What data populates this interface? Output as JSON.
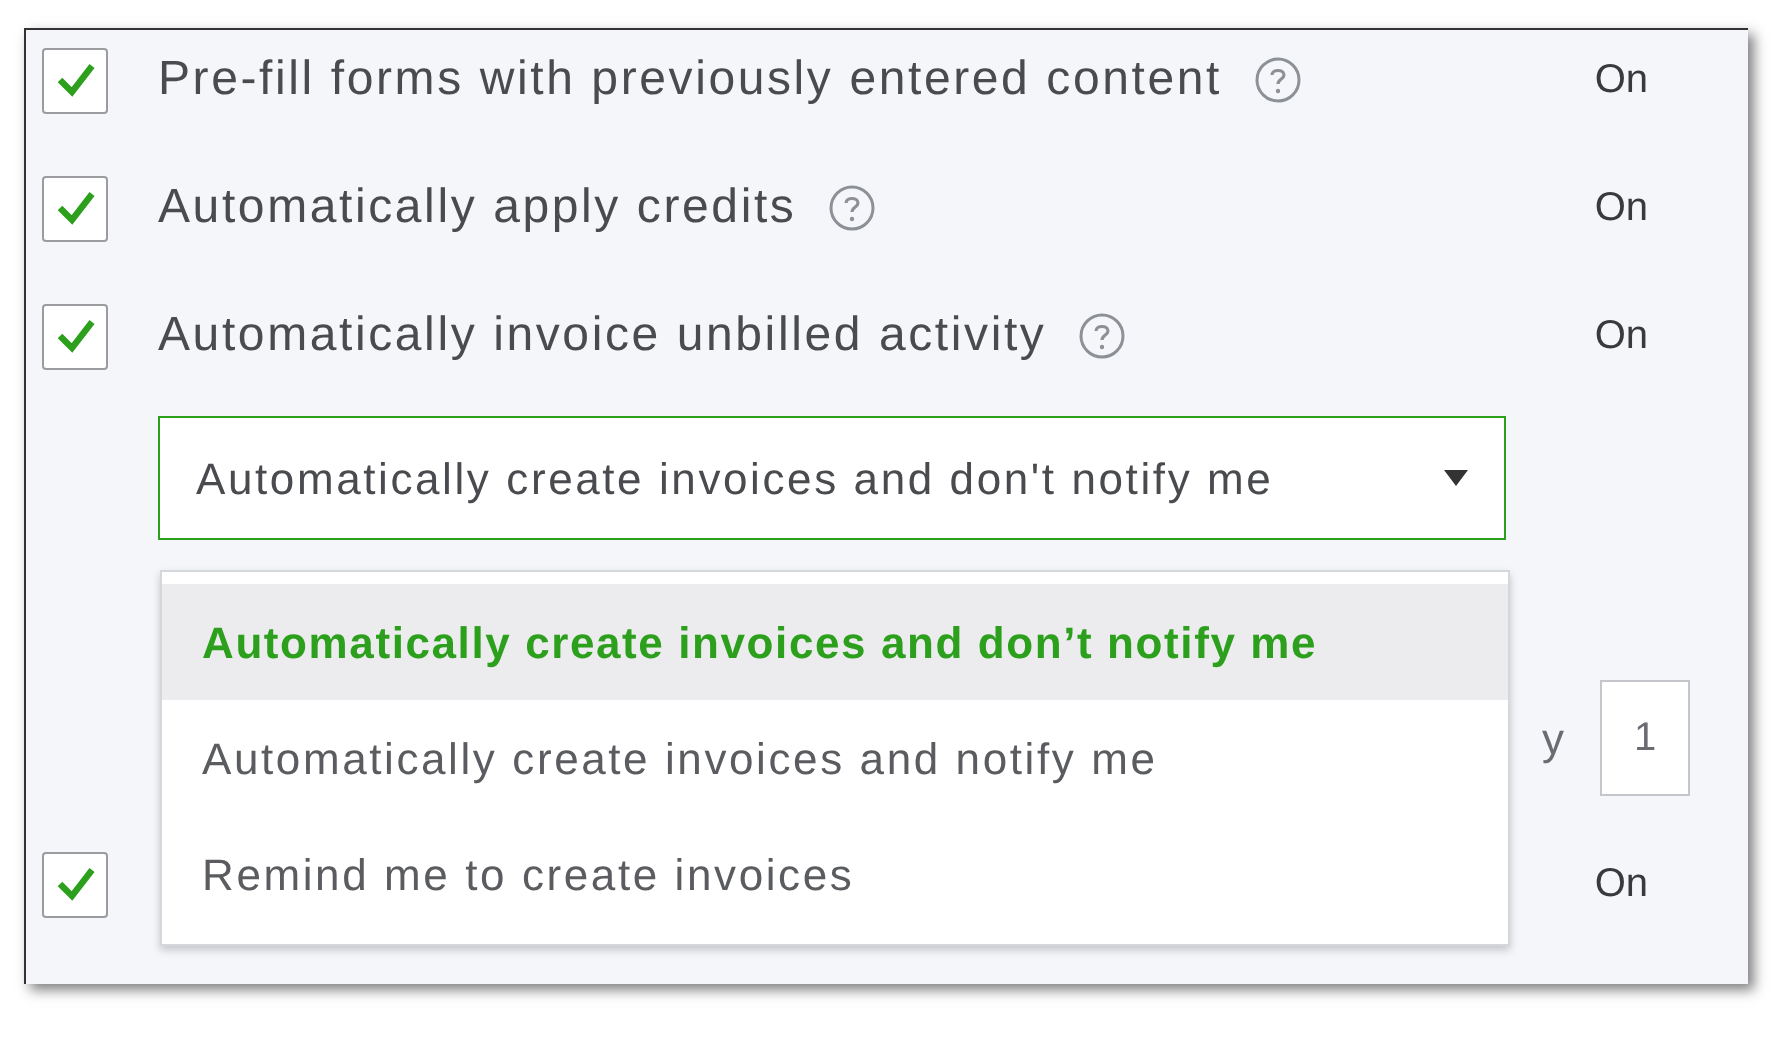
{
  "settings": [
    {
      "label": "Pre-fill forms with previously entered content",
      "checked": true,
      "help": true,
      "status": "On"
    },
    {
      "label": "Automatically apply credits",
      "checked": true,
      "help": true,
      "status": "On"
    },
    {
      "label": "Automatically invoice unbilled activity",
      "checked": true,
      "help": true,
      "status": "On"
    }
  ],
  "invoice_mode": {
    "value": "Automatically create invoices and don't notify me",
    "expanded": true,
    "options": [
      {
        "label": "Automatically create invoices and don’t notify me",
        "selected": true
      },
      {
        "label": "Automatically create invoices and notify me",
        "selected": false
      },
      {
        "label": "Remind me to create invoices",
        "selected": false
      }
    ]
  },
  "hidden_row": {
    "label_tail": "y",
    "value": "1"
  },
  "last_setting": {
    "checked": true,
    "status": "On"
  }
}
